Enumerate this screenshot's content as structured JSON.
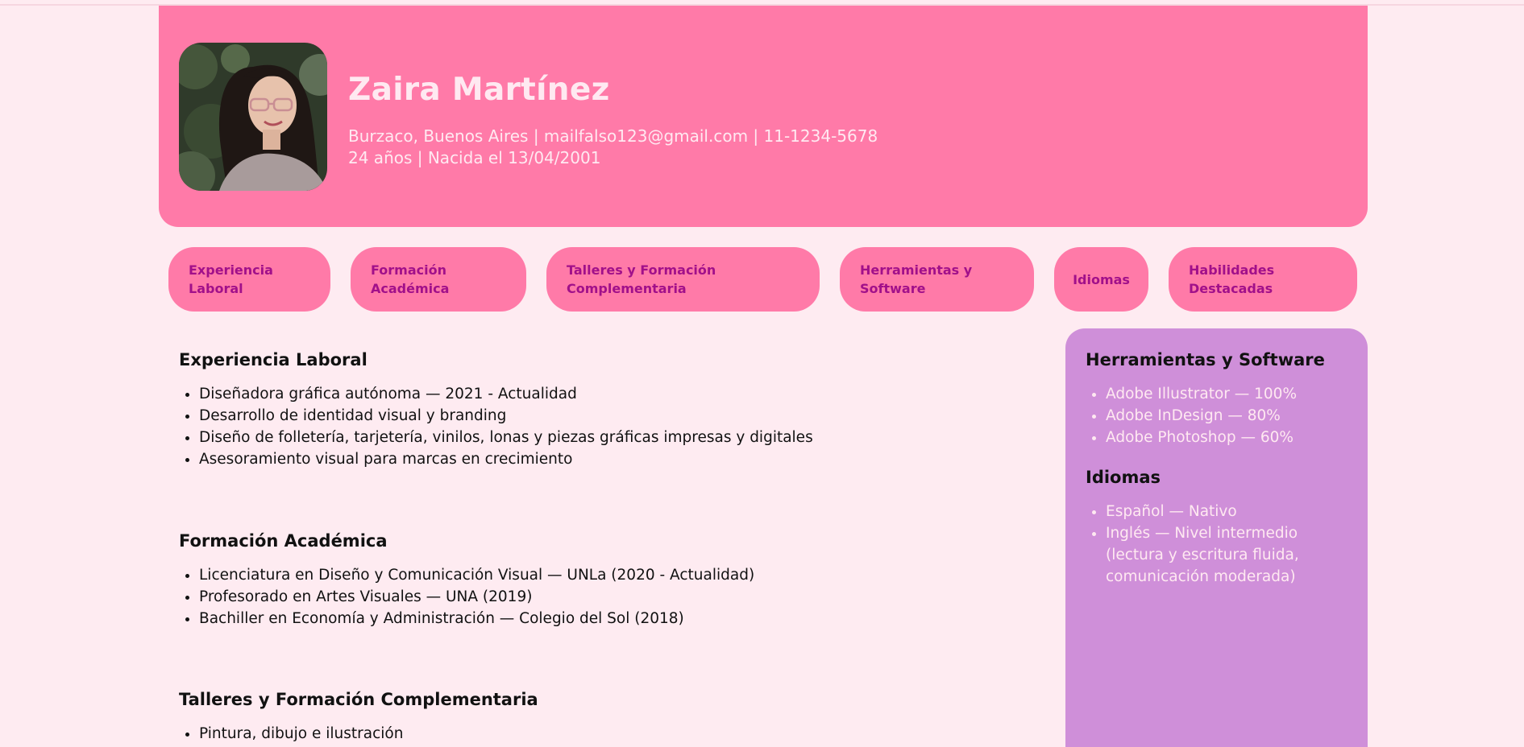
{
  "profile": {
    "name": "Zaira Martínez",
    "contact": "Burzaco, Buenos Aires | mailfalso123@gmail.com | 11-1234-5678",
    "age_birth": "24 años | Nacida el 13/04/2001"
  },
  "nav": {
    "items": [
      {
        "label": "Experiencia Laboral"
      },
      {
        "label": "Formación Académica"
      },
      {
        "label": "Talleres y Formación Complementaria"
      },
      {
        "label": "Herramientas y Software"
      },
      {
        "label": "Idiomas"
      },
      {
        "label": "Habilidades Destacadas"
      }
    ]
  },
  "sections": {
    "experience": {
      "title": "Experiencia Laboral",
      "items": [
        "Diseñadora gráfica autónoma — 2021 - Actualidad",
        "Desarrollo de identidad visual y branding",
        "Diseño de folletería, tarjetería, vinilos, lonas y piezas gráficas impresas y digitales",
        "Asesoramiento visual para marcas en crecimiento"
      ]
    },
    "education": {
      "title": "Formación Académica",
      "items": [
        "Licenciatura en Diseño y Comunicación Visual — UNLa (2020 - Actualidad)",
        "Profesorado en Artes Visuales — UNA (2019)",
        "Bachiller en Economía y Administración — Colegio del Sol (2018)"
      ]
    },
    "workshops": {
      "title": "Talleres y Formación Complementaria",
      "items": [
        "Pintura, dibujo e ilustración"
      ]
    }
  },
  "sidebar": {
    "tools": {
      "title": "Herramientas y Software",
      "items": [
        "Adobe Illustrator — 100%",
        "Adobe InDesign — 80%",
        "Adobe Photoshop — 60%"
      ]
    },
    "languages": {
      "title": "Idiomas",
      "items": [
        "Español — Nativo",
        "Inglés — Nivel intermedio (lectura y escritura fluida, comunicación moderada)"
      ]
    }
  },
  "colors": {
    "page_bg": "#feebf1",
    "header_bg": "#ff7aa8",
    "nav_text": "#a1108a",
    "sidebar_bg": "#cf8fd9",
    "light_text": "#ffe9f1"
  }
}
